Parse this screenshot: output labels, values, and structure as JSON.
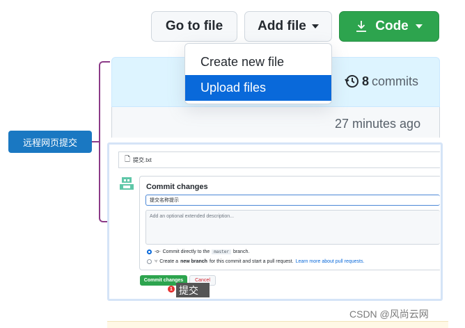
{
  "toolbar": {
    "go_to_file": "Go to file",
    "add_file": "Add file",
    "code": "Code"
  },
  "dropdown": {
    "items": [
      "Create new file",
      "Upload files"
    ],
    "selected": "Upload files"
  },
  "repo": {
    "commits_count": "8",
    "commits_label": "commits",
    "last_updated": "27 minutes ago"
  },
  "annotation": {
    "label": "远程网页提交"
  },
  "commit_form": {
    "file_name": "提交.txt",
    "title": "Commit changes",
    "message_value": "提交名称提示",
    "description_placeholder": "Add an optional extended description...",
    "option_direct_prefix": "Commit directly to the",
    "branch_name": "master",
    "option_direct_suffix": "branch.",
    "option_new_pre": "Create a",
    "option_new_bold": "new branch",
    "option_new_post": "for this commit and start a pull request.",
    "option_new_link": "Learn more about pull requests.",
    "commit_button": "Commit changes",
    "cancel_button": "Cancel",
    "step_badge": "1",
    "tooltip": "提交"
  },
  "watermark": "CSDN @风尚云网",
  "colors": {
    "accent_blue": "#0969da",
    "green": "#2da44e",
    "annotation_purple": "#8b3a87",
    "label_blue": "#1a78c2"
  }
}
